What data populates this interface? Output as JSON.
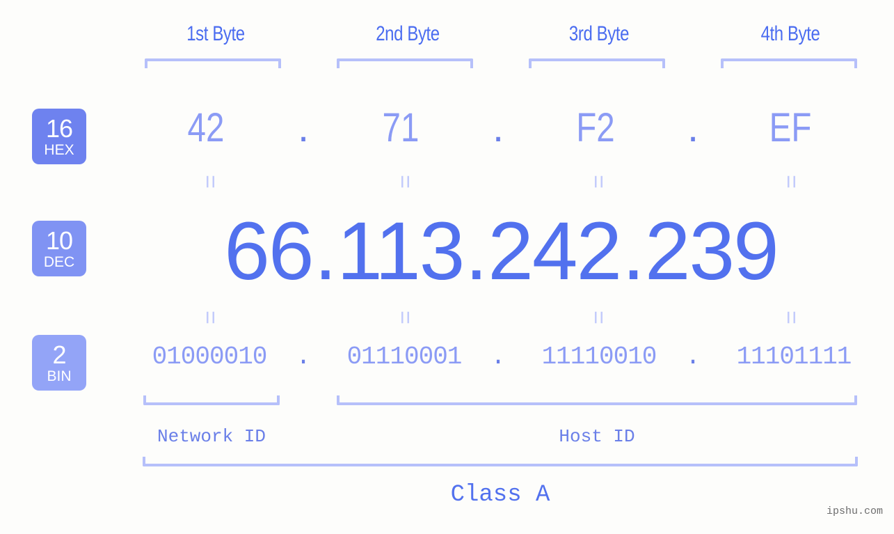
{
  "page": {
    "background_color": "#fdfdfb",
    "watermark": "ipshu.com"
  },
  "colors": {
    "accent_strong": "#5271ee",
    "accent_mid": "#6a7fe8",
    "accent_light": "#8b9bf5",
    "bracket": "#b6c0fa",
    "badge_hex": "#6e82ef",
    "badge_dec": "#8093f3",
    "badge_bin": "#93a4f7"
  },
  "byte_headers": [
    {
      "label": "1st Byte"
    },
    {
      "label": "2nd Byte"
    },
    {
      "label": "3rd Byte"
    },
    {
      "label": "4th Byte"
    }
  ],
  "bases": [
    {
      "number": "16",
      "name": "HEX"
    },
    {
      "number": "10",
      "name": "DEC"
    },
    {
      "number": "2",
      "name": "BIN"
    }
  ],
  "separator": ".",
  "equals_mark": "=",
  "rows": {
    "hex": {
      "base": "16",
      "base_name": "HEX",
      "values": [
        "42",
        "71",
        "F2",
        "EF"
      ]
    },
    "dec": {
      "base": "10",
      "base_name": "DEC",
      "values": [
        "66",
        "113",
        "242",
        "239"
      ]
    },
    "bin": {
      "base": "2",
      "base_name": "BIN",
      "values": [
        "01000010",
        "01110001",
        "11110010",
        "11101111"
      ]
    }
  },
  "segments": {
    "network_id": "Network ID",
    "host_id": "Host ID",
    "ip_class": "Class A"
  }
}
